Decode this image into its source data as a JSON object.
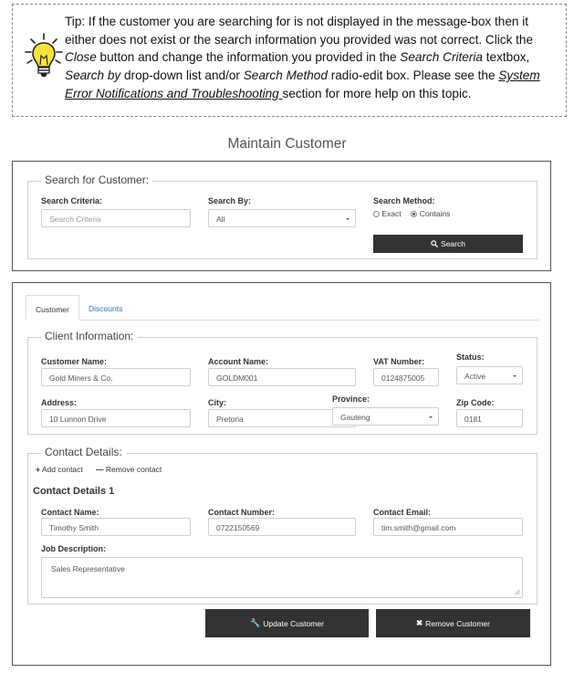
{
  "tip": {
    "lines": [
      "Tip: If the customer you are searching for is not displayed in the message-box then it",
      "either does not exist or the search information you provided was not correct. Click the",
      "Close",
      " button and change the information you provided in the ",
      "Search Criteria",
      " textbox,",
      "Search by",
      " drop-down list and/or ",
      "Search Method",
      " radio-edit box. Please see the ",
      "System",
      "Error Notifications and Troubleshooting ",
      "section for more help on this topic."
    ]
  },
  "page_title": "Maintain Customer",
  "search": {
    "legend": "Search for Customer:",
    "criteria_label": "Search Criteria:",
    "criteria_placeholder": "Search Criteria",
    "by_label": "Search By:",
    "by_value": "All",
    "method_label": "Search Method:",
    "method_exact": "Exact",
    "method_contains": "Contains",
    "button": "Search"
  },
  "tabs": [
    "Customer",
    "Discounts"
  ],
  "client": {
    "legend": "Client Information:",
    "customer_name_label": "Customer Name:",
    "customer_name": "Gold Miners & Co.",
    "account_name_label": "Account Name:",
    "account_name": "GOLDM001",
    "vat_label": "VAT Number:",
    "vat": "0124875005",
    "status_label": "Status:",
    "status": "Active",
    "address_label": "Address:",
    "address": "10 Lunnon Drive",
    "city_label": "City:",
    "city": "Pretoria",
    "province_label": "Province:",
    "province": "Gauteng",
    "zip_label": "Zip Code:",
    "zip": "0181"
  },
  "contact": {
    "legend": "Contact Details:",
    "add": "Add contact",
    "remove": "Remove contact",
    "heading": "Contact Details 1",
    "name_label": "Contact Name:",
    "name": "Timothy Smith",
    "number_label": "Contact Number:",
    "number": "0722150569",
    "email_label": "Contact Email:",
    "email": "tim.smith@gmail.com",
    "job_label": "Job Description:",
    "job": "Sales Representative"
  },
  "actions": {
    "update": "Update Customer",
    "remove": "Remove Customer"
  }
}
